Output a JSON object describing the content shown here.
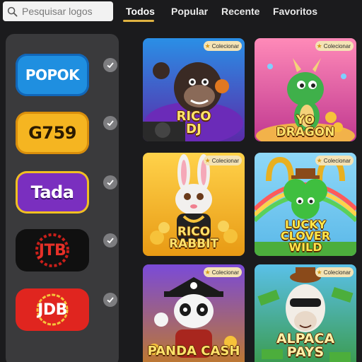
{
  "search": {
    "placeholder": "Pesquisar logos"
  },
  "tabs": [
    {
      "label": "Todos",
      "active": true
    },
    {
      "label": "Popular"
    },
    {
      "label": "Recente"
    },
    {
      "label": "Favoritos"
    }
  ],
  "accent_color": "#e0b341",
  "providers": [
    {
      "label": "POPOK",
      "bg": "#1f8fe0",
      "fg": "#ffffff",
      "selected": true
    },
    {
      "label": "G759",
      "bg": "#f5b521",
      "fg": "#2b1a00",
      "selected": true
    },
    {
      "label": "Tada",
      "bg": "#7a2fbf",
      "fg": "#ffffff",
      "selected": true
    },
    {
      "label": "JTB",
      "bg": "#101010",
      "fg": "#e63028",
      "selected": true
    },
    {
      "label": "JDB",
      "bg": "#e0251f",
      "fg": "#ffffff",
      "selected": true
    }
  ],
  "games": [
    {
      "title_line1": "RICO",
      "title_line2": "DJ",
      "badge": "Colecionar",
      "character": "gorilla-dj"
    },
    {
      "title_line1": "YO",
      "title_line2": "DRAGON",
      "badge": "Colecionar",
      "character": "green-dragon"
    },
    {
      "title_line1": "RICO",
      "title_line2": "RABBIT",
      "badge": "Colecionar",
      "character": "rabbit"
    },
    {
      "title_line1": "LUCKY",
      "title_line2": "CLOVER",
      "title_line3": "WILD",
      "badge": "Colecionar",
      "character": "clover"
    },
    {
      "title_line1": "PANDA CASH",
      "title_line2": "",
      "badge": "Colecionar",
      "character": "panda-pirate"
    },
    {
      "title_line1": "ALPACA",
      "title_line2": "PAYS",
      "badge": "Colecionar",
      "character": "alpaca"
    }
  ]
}
